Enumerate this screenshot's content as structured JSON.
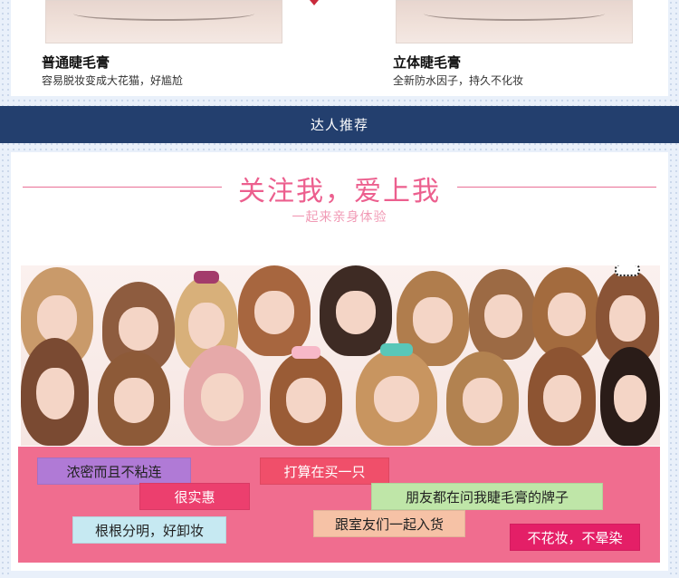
{
  "compare": {
    "left": {
      "title": "普通睫毛膏",
      "desc": "容易脱妆变成大花猫，好尴尬"
    },
    "right": {
      "title": "立体睫毛膏",
      "desc": "全新防水因子，持久不化妆"
    }
  },
  "banner": {
    "label": "达人推荐"
  },
  "promo": {
    "headline": "关注我，爱上我",
    "subline": "一起来亲身体验"
  },
  "tags": [
    {
      "text": "浓密而且不粘连",
      "color": "#b07ad6"
    },
    {
      "text": "很实惠",
      "color": "#ec3f6e"
    },
    {
      "text": "根根分明，好卸妆",
      "color": "#c6e9f2"
    },
    {
      "text": "打算在买一只",
      "color": "#f04f6a"
    },
    {
      "text": "朋友都在问我睫毛膏的牌子",
      "color": "#bfe6a8"
    },
    {
      "text": "跟室友们一起入货",
      "color": "#f6c2a6"
    },
    {
      "text": "不花妆，不晕染",
      "color": "#e41f67"
    }
  ],
  "colors": {
    "banner": "#233f6e",
    "accent_pink": "#ec5f8e",
    "tag_background": "#f06d8f"
  }
}
